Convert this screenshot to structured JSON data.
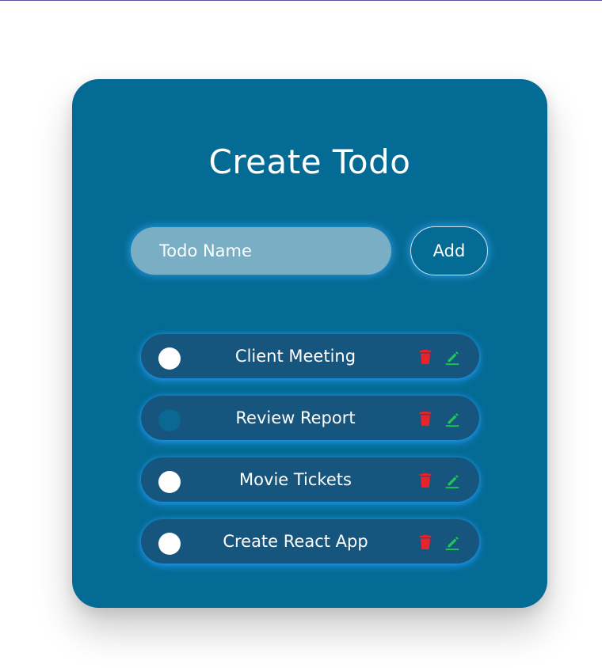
{
  "app": {
    "title": "Create Todo"
  },
  "input": {
    "placeholder": "Todo Name",
    "value": ""
  },
  "add_button": {
    "label": "Add"
  },
  "colors": {
    "card_bg": "#046b94",
    "item_bg": "#15557e",
    "glow": "#38aaff",
    "delete": "#e8232c",
    "edit": "#20c45a"
  },
  "todos": [
    {
      "label": "Client Meeting",
      "completed": false
    },
    {
      "label": "Review Report",
      "completed": true
    },
    {
      "label": "Movie Tickets",
      "completed": false
    },
    {
      "label": "Create React App",
      "completed": false
    }
  ],
  "icons": {
    "delete": "trash-icon",
    "edit": "pencil-icon"
  }
}
